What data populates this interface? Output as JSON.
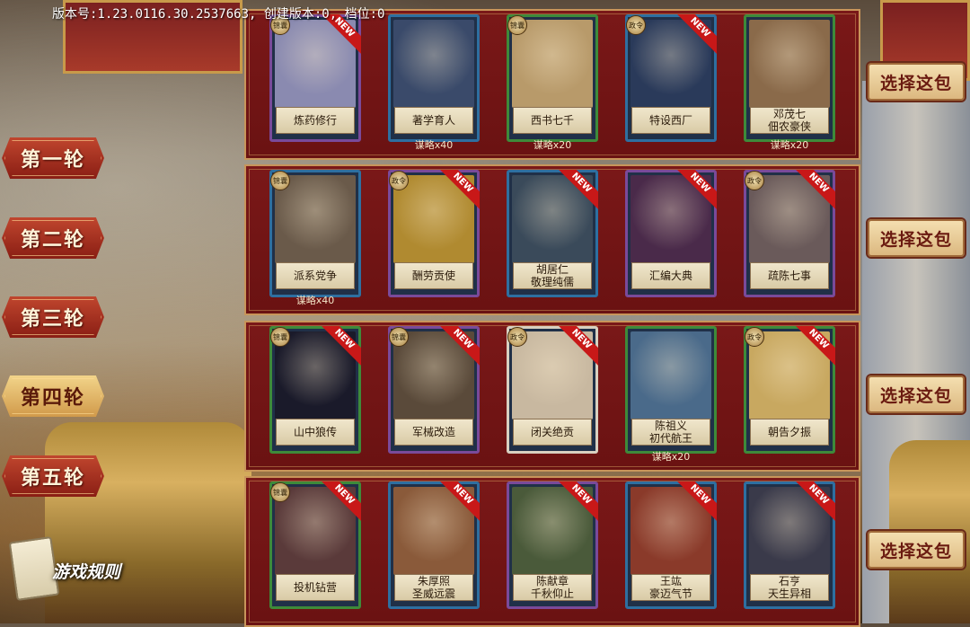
{
  "version_text": "版本号:1.23.0116.30.2537663, 创建版本:0, 档位:0",
  "rounds": [
    {
      "label": "第一轮",
      "active": false
    },
    {
      "label": "第二轮",
      "active": false
    },
    {
      "label": "第三轮",
      "active": false
    },
    {
      "label": "第四轮",
      "active": true
    },
    {
      "label": "第五轮",
      "active": false
    }
  ],
  "rules_label": "游戏规则",
  "choose_label": "选择这包",
  "packs": [
    {
      "cards": [
        {
          "name1": "炼药修行",
          "name2": "",
          "frame": "purple",
          "badge": "锦囊",
          "new": true,
          "cost": "",
          "art": "#8a8ab0"
        },
        {
          "name1": "著学育人",
          "name2": "",
          "frame": "blue",
          "badge": "",
          "new": false,
          "cost": "谋略x40",
          "art": "#3a4a6a"
        },
        {
          "name1": "西书七千",
          "name2": "",
          "frame": "green",
          "badge": "锦囊",
          "new": false,
          "cost": "谋略x20",
          "art": "#b89a6a"
        },
        {
          "name1": "特设西厂",
          "name2": "",
          "frame": "blue",
          "badge": "政令",
          "new": true,
          "cost": "",
          "art": "#2a3a5a"
        },
        {
          "name1": "邓茂七",
          "name2": "佃农豪侠",
          "frame": "green",
          "badge": "",
          "new": false,
          "cost": "谋略x20",
          "art": "#8a6a4a"
        }
      ]
    },
    {
      "cards": [
        {
          "name1": "派系党争",
          "name2": "",
          "frame": "blue",
          "badge": "锦囊",
          "new": false,
          "cost": "谋略x40",
          "art": "#6a5a4a"
        },
        {
          "name1": "酬劳贡使",
          "name2": "",
          "frame": "purple",
          "badge": "政令",
          "new": true,
          "cost": "",
          "art": "#b08a30"
        },
        {
          "name1": "胡居仁",
          "name2": "敬理纯儒",
          "frame": "blue",
          "badge": "",
          "new": true,
          "cost": "",
          "art": "#3a4a5a"
        },
        {
          "name1": "汇编大典",
          "name2": "",
          "frame": "purple",
          "badge": "",
          "new": true,
          "cost": "",
          "art": "#4a2a4a"
        },
        {
          "name1": "疏陈七事",
          "name2": "",
          "frame": "purple",
          "badge": "政令",
          "new": true,
          "cost": "",
          "art": "#6a5a5a"
        }
      ]
    },
    {
      "cards": [
        {
          "name1": "山中狼传",
          "name2": "",
          "frame": "green",
          "badge": "锦囊",
          "new": true,
          "cost": "",
          "art": "#1a1a2a"
        },
        {
          "name1": "军械改造",
          "name2": "",
          "frame": "purple",
          "badge": "锦囊",
          "new": true,
          "cost": "",
          "art": "#5a4a3a"
        },
        {
          "name1": "闭关绝贡",
          "name2": "",
          "frame": "white",
          "badge": "政令",
          "new": true,
          "cost": "",
          "art": "#c8b8a0"
        },
        {
          "name1": "陈祖义",
          "name2": "初代航王",
          "frame": "green",
          "badge": "",
          "new": false,
          "cost": "谋略x20",
          "art": "#4a6a8a"
        },
        {
          "name1": "朝告夕振",
          "name2": "",
          "frame": "green",
          "badge": "政令",
          "new": true,
          "cost": "",
          "art": "#c8a860"
        }
      ]
    },
    {
      "cards": [
        {
          "name1": "投机钻营",
          "name2": "",
          "frame": "green",
          "badge": "锦囊",
          "new": true,
          "cost": "",
          "art": "#5a3a3a"
        },
        {
          "name1": "朱厚照",
          "name2": "圣威远震",
          "frame": "blue",
          "badge": "",
          "new": true,
          "cost": "",
          "art": "#8a5a3a"
        },
        {
          "name1": "陈献章",
          "name2": "千秋仰止",
          "frame": "purple",
          "badge": "",
          "new": true,
          "cost": "",
          "art": "#4a5a3a"
        },
        {
          "name1": "王竑",
          "name2": "豪迈气节",
          "frame": "blue",
          "badge": "",
          "new": true,
          "cost": "",
          "art": "#8a3a2a"
        },
        {
          "name1": "石亨",
          "name2": "天生异相",
          "frame": "blue",
          "badge": "",
          "new": true,
          "cost": "",
          "art": "#3a3a4a"
        }
      ]
    }
  ],
  "new_label": "NEW"
}
